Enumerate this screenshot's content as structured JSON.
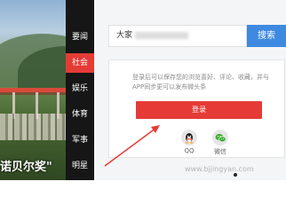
{
  "photo": {
    "caption": "诺贝尔奖\""
  },
  "nav": {
    "items": [
      {
        "label": "要闻",
        "active": false
      },
      {
        "label": "社会",
        "active": true
      },
      {
        "label": "娱乐",
        "active": false
      },
      {
        "label": "体育",
        "active": false
      },
      {
        "label": "军事",
        "active": false
      },
      {
        "label": "明星",
        "active": false
      }
    ]
  },
  "search": {
    "value": "大家",
    "button_label": "搜索"
  },
  "login": {
    "description": "登录后可以保存您的浏览喜好、评论、收藏，并与APP同步更可以发布微头条",
    "button_label": "登录",
    "qq_label": "QQ",
    "wechat_label": "微信"
  },
  "watermark": "www.bjjingyan.com",
  "colors": {
    "accent_red": "#e53b36",
    "search_blue": "#3d8ae0",
    "nav_bg": "#161616"
  }
}
